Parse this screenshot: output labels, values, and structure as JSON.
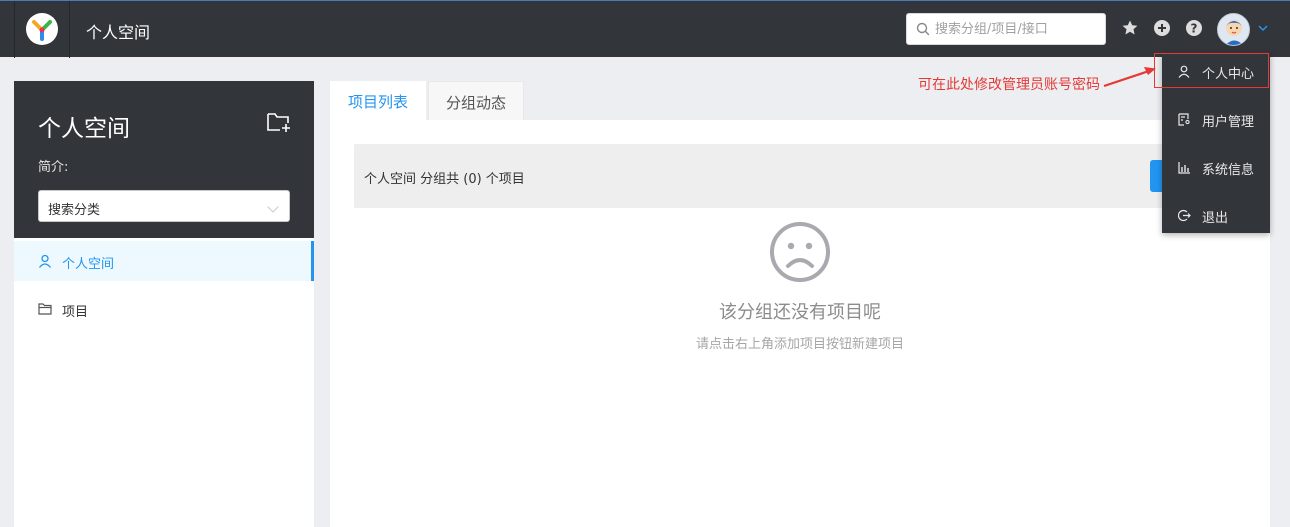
{
  "header": {
    "title": "个人空间",
    "search_placeholder": "搜索分组/项目/接口"
  },
  "sidebar": {
    "title": "个人空间",
    "intro_label": "简介:",
    "category_select": "搜索分类",
    "items": [
      {
        "label": "个人空间",
        "icon": "user-icon",
        "active": true
      },
      {
        "label": "项目",
        "icon": "folder-icon",
        "active": false
      }
    ]
  },
  "tabs": [
    {
      "label": "项目列表",
      "active": true
    },
    {
      "label": "分组动态",
      "active": false
    }
  ],
  "main": {
    "summary": "个人空间 分组共 (0) 个项目",
    "empty_title": "该分组还没有项目呢",
    "empty_subtitle": "请点击右上角添加项目按钮新建项目"
  },
  "user_menu": {
    "items": [
      {
        "label": "个人中心",
        "icon": "user-icon"
      },
      {
        "label": "用户管理",
        "icon": "user-manage-icon"
      },
      {
        "label": "系统信息",
        "icon": "bar-chart-icon"
      },
      {
        "label": "退出",
        "icon": "logout-icon"
      }
    ]
  },
  "annotation": {
    "text": "可在此处修改管理员账号密码"
  },
  "colors": {
    "header_bg": "#32363a",
    "accent": "#2395f1",
    "annotation": "#e53935"
  }
}
